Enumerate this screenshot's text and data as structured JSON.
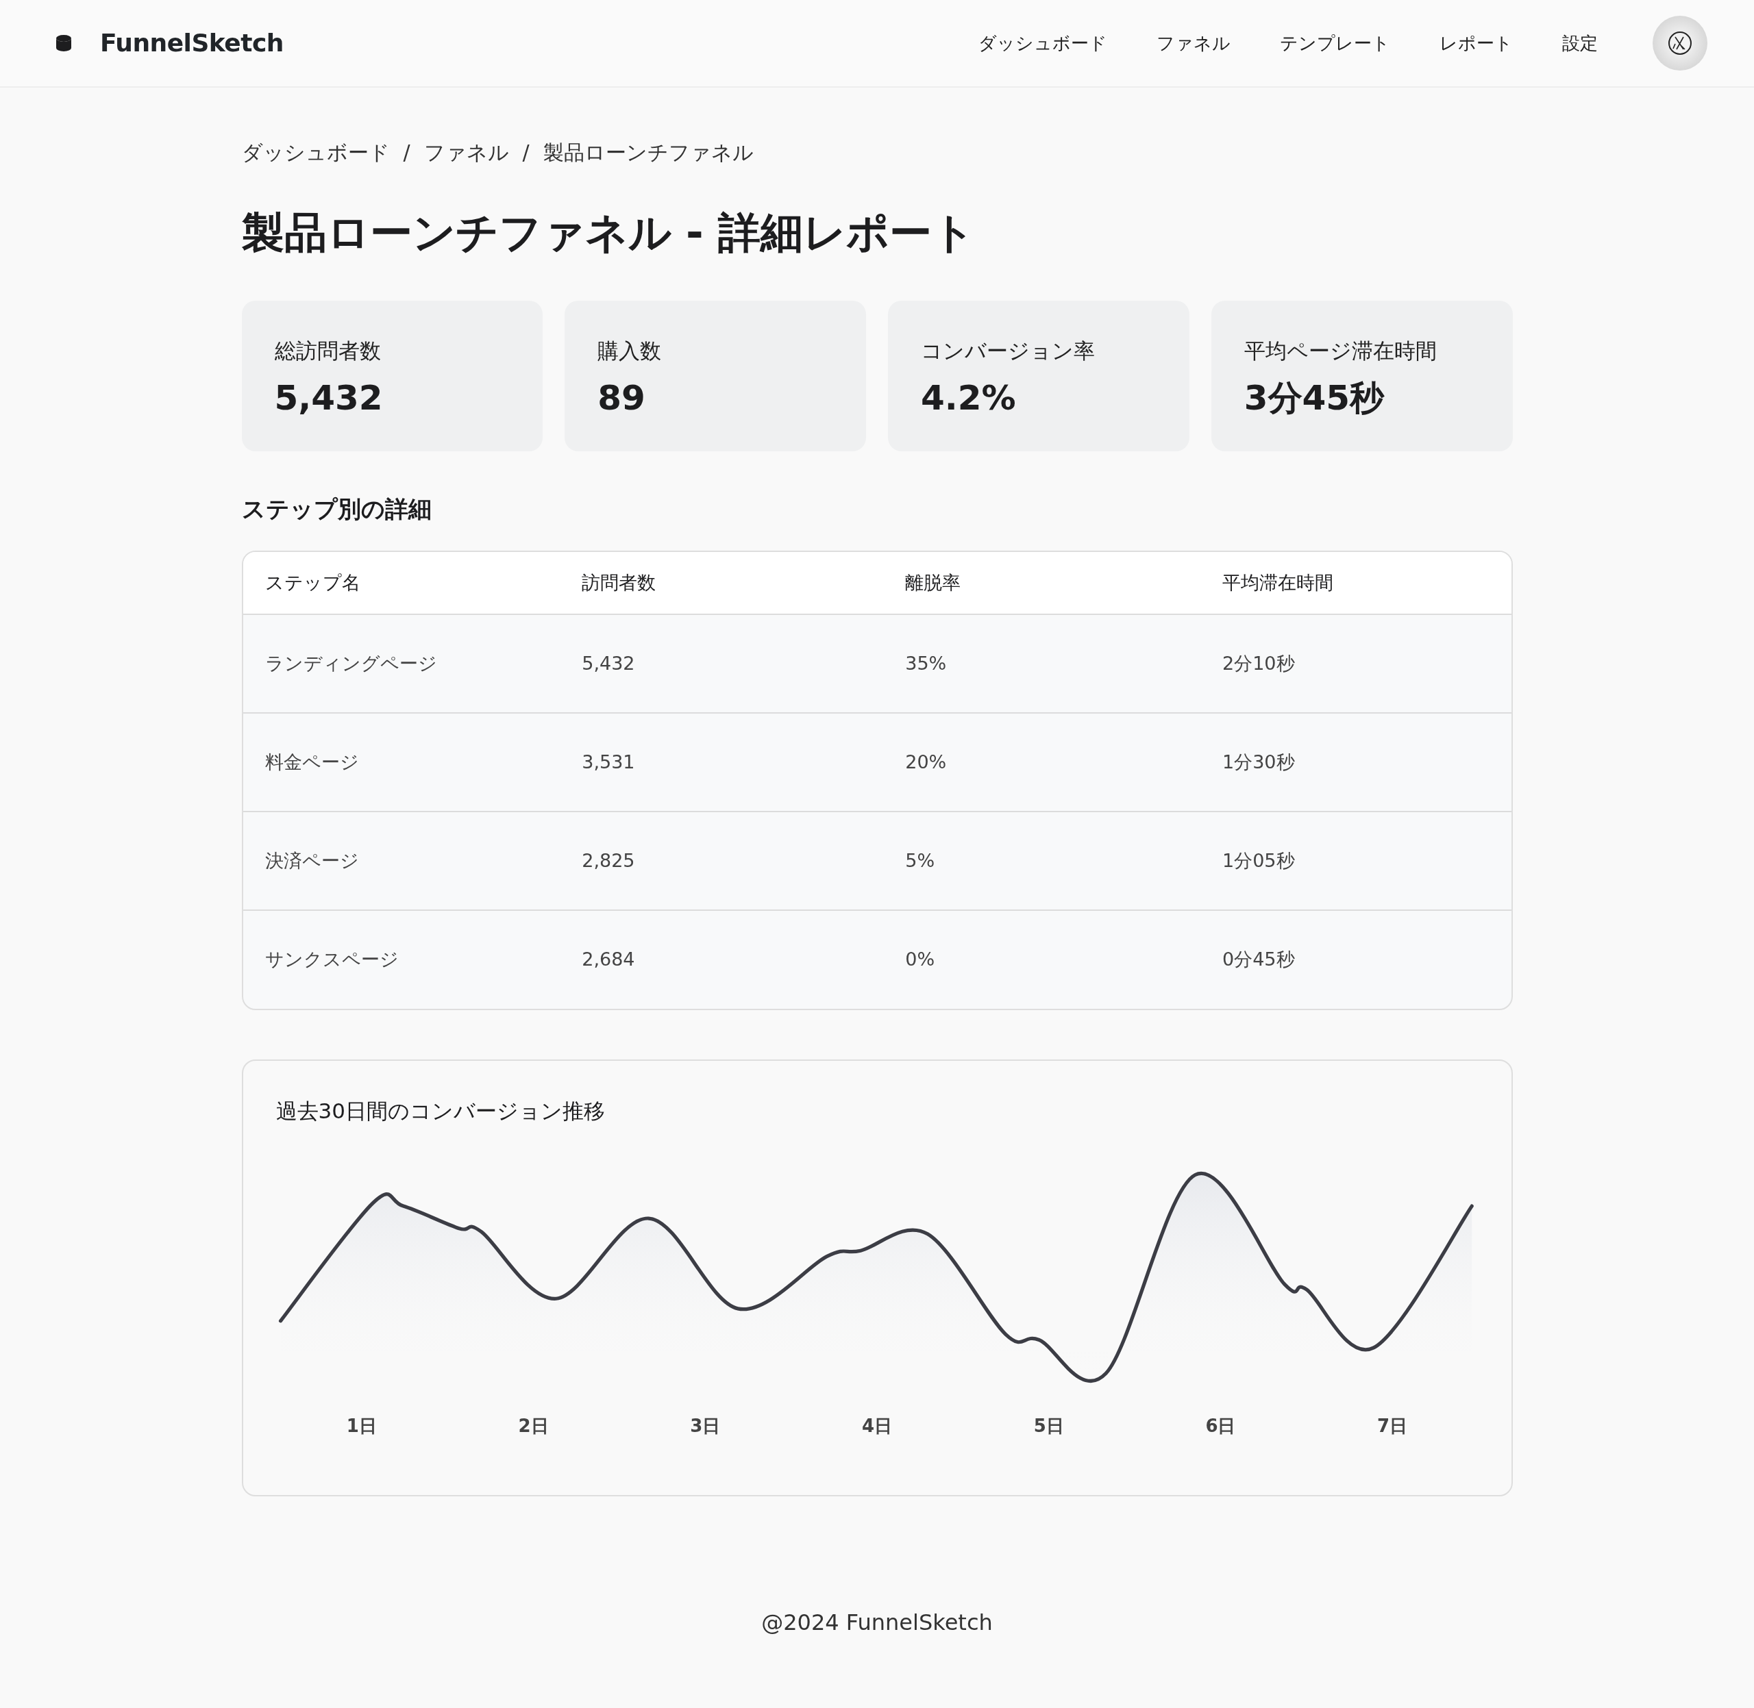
{
  "header": {
    "logo": "FunnelSketch",
    "nav": [
      {
        "label": "ダッシュボード"
      },
      {
        "label": "ファネル"
      },
      {
        "label": "テンプレート"
      },
      {
        "label": "レポート"
      },
      {
        "label": "設定"
      }
    ]
  },
  "breadcrumb": {
    "items": [
      "ダッシュボード",
      "ファネル",
      "製品ローンチファネル"
    ],
    "separators": [
      "/",
      "/"
    ]
  },
  "title": "製品ローンチファネル - 詳細レポート",
  "stats": [
    {
      "label": "総訪問者数",
      "value": "5,432"
    },
    {
      "label": "購入数",
      "value": "89"
    },
    {
      "label": "コンバージョン率",
      "value": "4.2%"
    },
    {
      "label": "平均ページ滞在時間",
      "value": "3分45秒"
    }
  ],
  "steps": {
    "heading": "ステップ別の詳細",
    "columns": [
      "ステップ名",
      "訪問者数",
      "離脱率",
      "平均滞在時間"
    ],
    "rows": [
      [
        "ランディングページ",
        "5,432",
        "35%",
        "2分10秒"
      ],
      [
        "料金ページ",
        "3,531",
        "20%",
        "1分30秒"
      ],
      [
        "決済ページ",
        "2,825",
        "5%",
        "1分05秒"
      ],
      [
        "サンクスページ",
        "2,684",
        "0%",
        "0分45秒"
      ]
    ]
  },
  "trend": {
    "title": "過去30日間のコンバージョン推移",
    "x_labels": [
      "1日",
      "2日",
      "3日",
      "4日",
      "5日",
      "6日",
      "7日"
    ]
  },
  "footer": "@2024 FunnelSketch"
}
